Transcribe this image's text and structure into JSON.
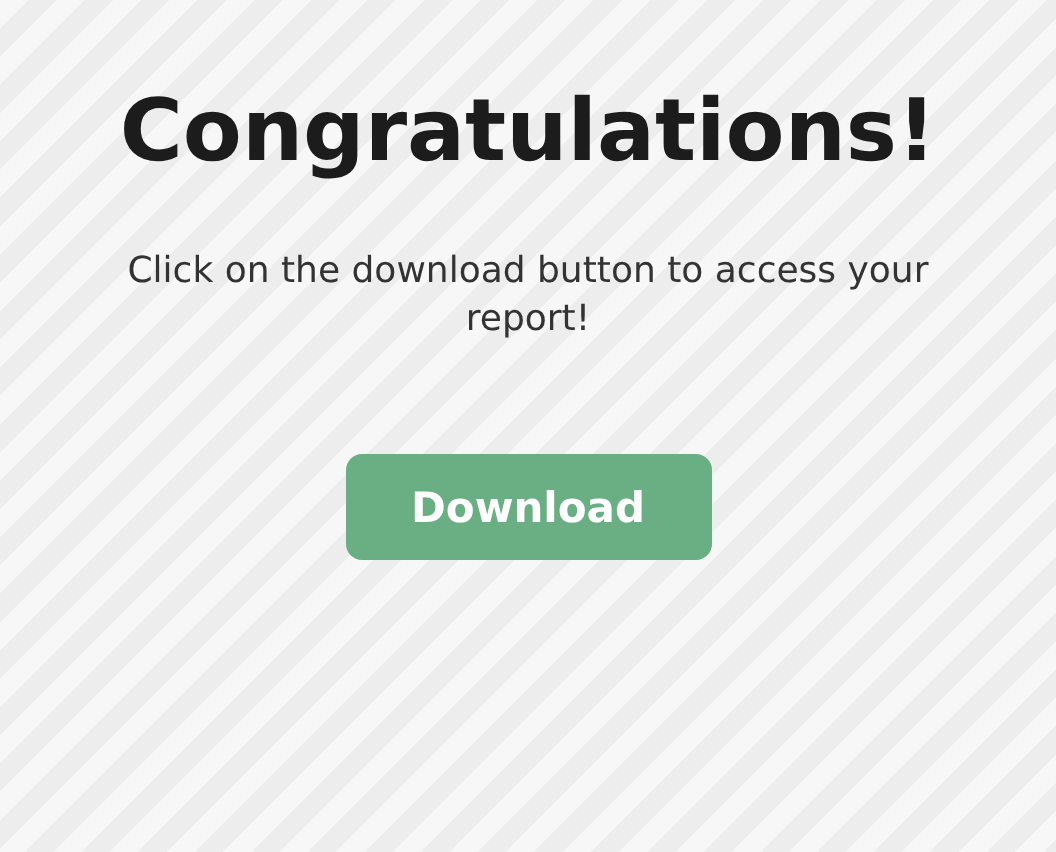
{
  "title": "Congratulations!",
  "message": "Click on the download button to access your report!",
  "button": {
    "label": "Download"
  }
}
